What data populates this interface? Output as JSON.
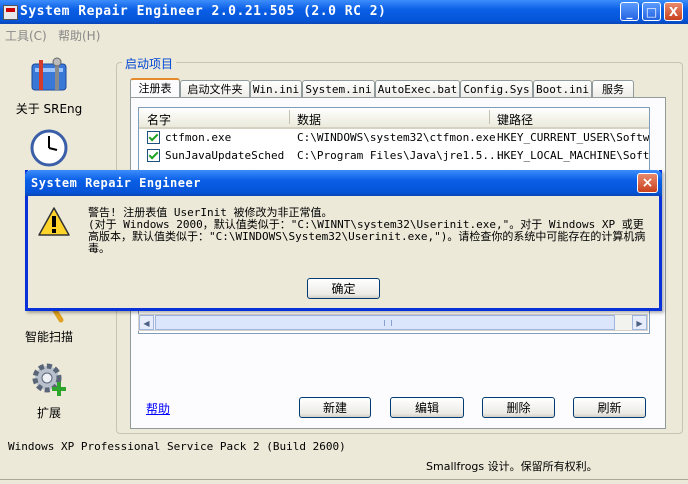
{
  "window": {
    "title": "System Repair Engineer 2.0.21.505 (2.0 RC 2)",
    "minimize": "_",
    "maximize": "□",
    "close": "X"
  },
  "menu": [
    {
      "label": "工具(C)"
    },
    {
      "label": "帮助(H)"
    }
  ],
  "sidebar": [
    {
      "label": "关于 SREng",
      "icon": "toolbox-icon"
    },
    {
      "label": "",
      "icon": "clock-icon"
    },
    {
      "label": "智能扫描",
      "icon": "magnifier-icon"
    },
    {
      "label": "扩展",
      "icon": "gear-plus-icon"
    }
  ],
  "group": {
    "label": "启动项目"
  },
  "tabs": [
    {
      "label": "注册表",
      "active": true
    },
    {
      "label": "启动文件夹"
    },
    {
      "label": "Win.ini"
    },
    {
      "label": "System.ini"
    },
    {
      "label": "AutoExec.bat"
    },
    {
      "label": "Config.Sys"
    },
    {
      "label": "Boot.ini"
    },
    {
      "label": "服务"
    }
  ],
  "list": {
    "columns": [
      "名字",
      "数据",
      "键路径"
    ],
    "rows": [
      {
        "name": "ctfmon.exe",
        "data": "C:\\WINDOWS\\system32\\ctfmon.exe",
        "path": "HKEY_CURRENT_USER\\Softwar",
        "checked": true
      },
      {
        "name": "SunJavaUpdateSched",
        "data": "C:\\Program Files\\Java\\jre1.5...",
        "path": "HKEY_LOCAL_MACHINE\\Softwa",
        "checked": true
      }
    ]
  },
  "buttons": {
    "help": "帮助",
    "new": "新建",
    "edit": "编辑",
    "delete": "删除",
    "refresh": "刷新"
  },
  "status": {
    "os": "Windows XP Professional Service Pack 2 (Build 2600)",
    "credit": "Smallfrogs 设计。保留所有权利。"
  },
  "dialog": {
    "title": "System Repair Engineer",
    "close": "×",
    "line1": "警告! 注册表值 UserInit 被修改为非正常值。",
    "line2": "(对于 Windows 2000，默认值类似于：\"C:\\WINNT\\system32\\Userinit.exe,\"。对于 Windows XP 或更高版本，默认值类似于：\"C:\\WINDOWS\\System32\\Userinit.exe,\")。请检查你的系统中可能存在的计算机病毒。",
    "ok": "确定",
    "icon": "warning-icon"
  },
  "colors": {
    "titlebar": "#0a5fe6",
    "accent_tab": "#e68b2c",
    "link": "#0000ff"
  }
}
